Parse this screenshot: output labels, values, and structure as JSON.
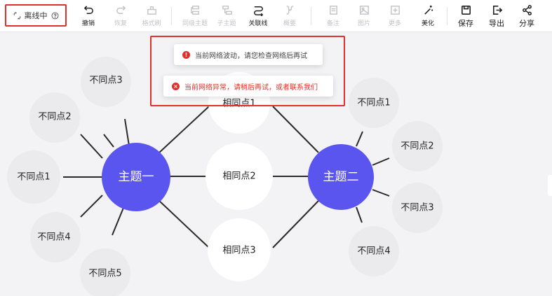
{
  "status": {
    "label": "离线中",
    "help_icon": "question-circle-icon",
    "status_icon": "broken-link-icon"
  },
  "toolbar": {
    "undo": "撤销",
    "redo": "恢复",
    "format_brush": "格式刷",
    "sibling_topic": "同级主题",
    "child_topic": "子主题",
    "relation_line": "关联线",
    "summary": "概要",
    "note": "备注",
    "image": "图片",
    "more": "更多",
    "beautify": "美化",
    "save": "保存",
    "export": "导出",
    "share": "分享"
  },
  "toasts": {
    "warning": "当前网络波动，请您检查网络后再试",
    "error": "当前网络异常，请稍后再试，或者联系我们"
  },
  "mindmap": {
    "topic1": "主题一",
    "topic2": "主题二",
    "common": [
      "相同点1",
      "相同点2",
      "相同点3"
    ],
    "left_diff": [
      "不同点3",
      "不同点2",
      "不同点1",
      "不同点4",
      "不同点5"
    ],
    "right_diff": [
      "不同点1",
      "不同点2",
      "不同点3",
      "不同点4"
    ]
  },
  "colors": {
    "topic": "#5b55f0",
    "alert": "#e0302a",
    "canvas": "#f3f3f5"
  }
}
